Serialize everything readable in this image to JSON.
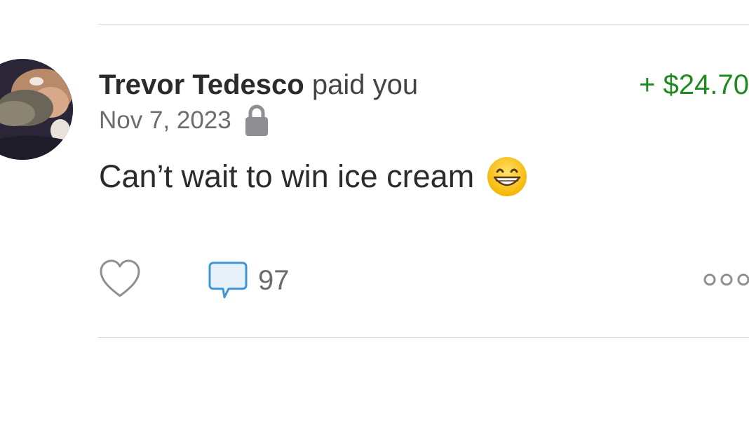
{
  "transaction": {
    "payer_name": "Trevor Tedesco",
    "action_text": "paid you",
    "amount": "+ $24.70",
    "amount_color": "#1f8a1f",
    "date": "Nov 7, 2023",
    "privacy_icon": "lock-icon",
    "note": "Can’t wait to win ice cream",
    "note_emoji": "grinning-face-with-smiling-eyes",
    "comment_count": "97"
  },
  "icons": {
    "like": "heart-outline-icon",
    "comment": "speech-bubble-icon",
    "more": "ellipsis-icon"
  }
}
